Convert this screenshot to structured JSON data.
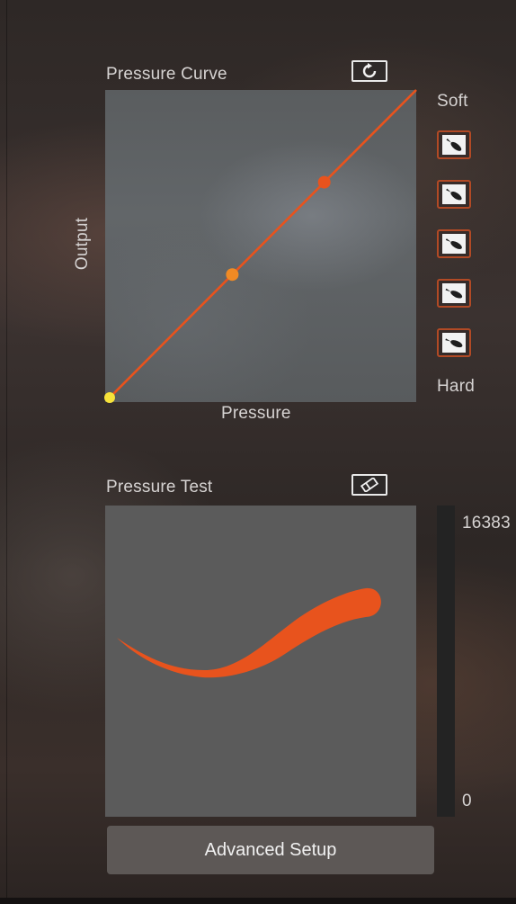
{
  "pressure_curve": {
    "title": "Pressure Curve",
    "reset_icon": "reset-icon",
    "x_axis_label": "Pressure",
    "y_axis_label": "Output",
    "points": [
      [
        0,
        0
      ],
      [
        0.4,
        0.4
      ],
      [
        0.7,
        0.7
      ],
      [
        1,
        1
      ]
    ],
    "curve_color": "#e8531d",
    "start_point_color": "#f7e23a",
    "mid_point_color": "#f08a24",
    "upper_point_color": "#e8531d"
  },
  "presets": {
    "soft_label": "Soft",
    "hard_label": "Hard",
    "items": [
      "pen-preset-icon",
      "pen-preset-icon",
      "pen-preset-icon",
      "pen-preset-icon",
      "pen-preset-icon"
    ],
    "border_color": "#b24a25"
  },
  "pressure_test": {
    "title": "Pressure Test",
    "clear_icon": "eraser-icon",
    "stroke_color": "#e8531d",
    "meter_max": "16383",
    "meter_min": "0"
  },
  "footer": {
    "advanced_setup_label": "Advanced Setup"
  }
}
